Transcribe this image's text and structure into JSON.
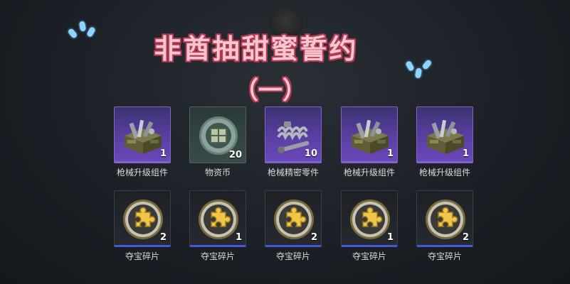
{
  "overlay": {
    "title": "非酋抽甜蜜誓约",
    "subtitle": "（一）"
  },
  "rows": [
    [
      {
        "name": "枪械升级组件",
        "count": "1",
        "icon": "weapon-upgrade-crate-icon",
        "rarity": "purple"
      },
      {
        "name": "物资币",
        "count": "20",
        "icon": "supply-coin-icon",
        "rarity": "dark"
      },
      {
        "name": "枪械精密零件",
        "count": "10",
        "icon": "spring-parts-icon",
        "rarity": "purple"
      },
      {
        "name": "枪械升级组件",
        "count": "1",
        "icon": "weapon-upgrade-crate-icon",
        "rarity": "purple"
      },
      {
        "name": "枪械升级组件",
        "count": "1",
        "icon": "weapon-upgrade-crate-icon",
        "rarity": "purple"
      }
    ],
    [
      {
        "name": "夺宝碎片",
        "count": "2",
        "icon": "puzzle-token-icon",
        "rarity": "dark"
      },
      {
        "name": "夺宝碎片",
        "count": "1",
        "icon": "puzzle-token-icon",
        "rarity": "dark"
      },
      {
        "name": "夺宝碎片",
        "count": "2",
        "icon": "puzzle-token-icon",
        "rarity": "dark"
      },
      {
        "name": "夺宝碎片",
        "count": "1",
        "icon": "puzzle-token-icon",
        "rarity": "dark"
      },
      {
        "name": "夺宝碎片",
        "count": "2",
        "icon": "puzzle-token-icon",
        "rarity": "dark"
      }
    ]
  ],
  "colors": {
    "rare_purple": "#5a3fa3",
    "accent_blue": "#3f5bd8",
    "overlay_pink": "#f7c6cf"
  }
}
